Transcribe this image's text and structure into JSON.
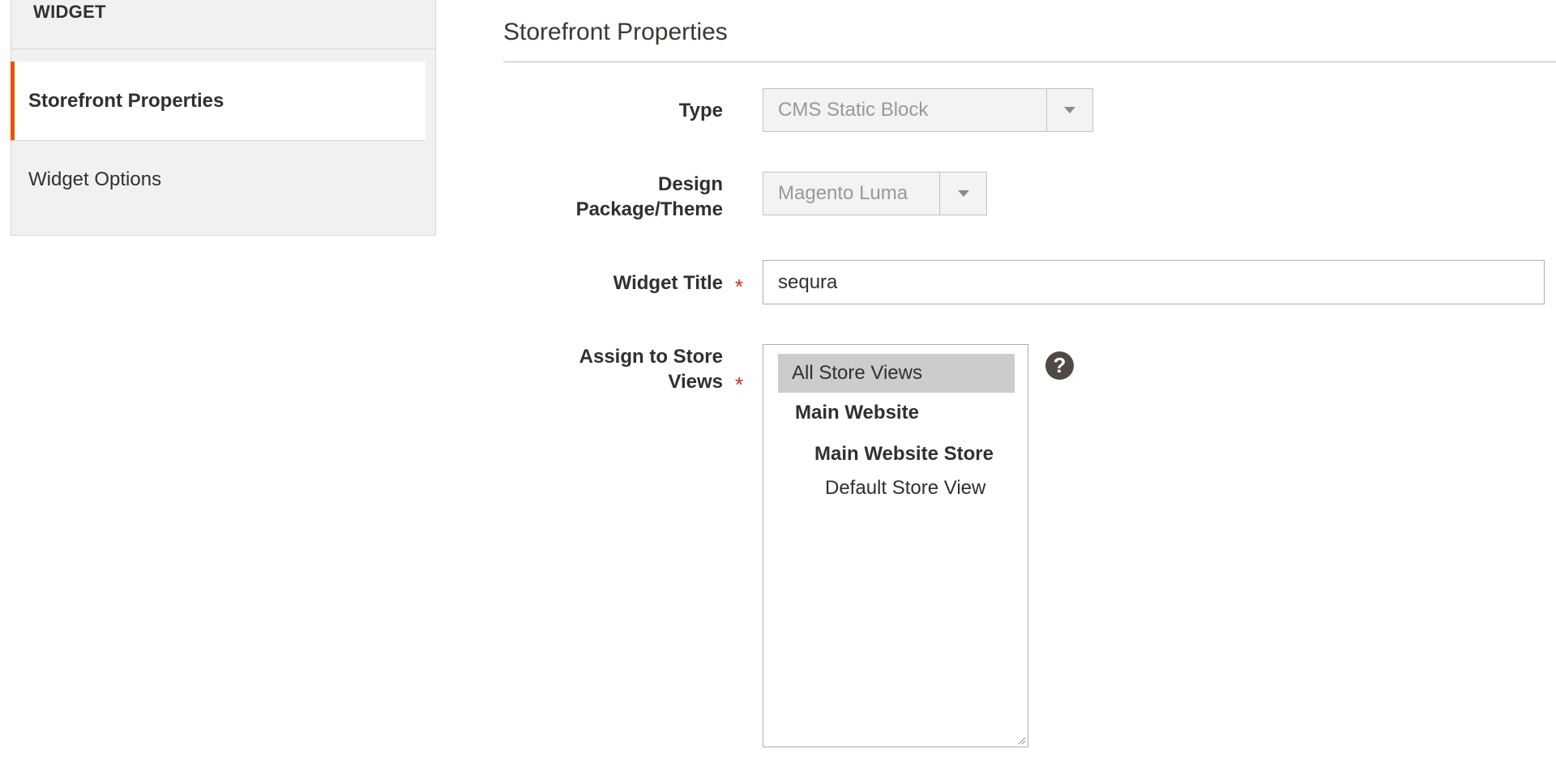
{
  "sidebar": {
    "heading": "WIDGET",
    "tabs": [
      {
        "label": "Storefront Properties",
        "active": true
      },
      {
        "label": "Widget Options",
        "active": false
      }
    ],
    "accent_color": "#eb5202"
  },
  "main": {
    "section_title": "Storefront Properties",
    "fields": {
      "type": {
        "label": "Type",
        "value": "CMS Static Block",
        "disabled": true
      },
      "design_theme": {
        "label_line1": "Design",
        "label_line2": "Package/Theme",
        "value": "Magento Luma",
        "disabled": true
      },
      "widget_title": {
        "label": "Widget Title",
        "required": true,
        "value": "sequra"
      },
      "store_views": {
        "label_line1": "Assign to Store",
        "label_line2": "Views",
        "required": true,
        "options": {
          "all": "All Store Views",
          "website": "Main Website",
          "store": "Main Website Store",
          "view": "Default Store View"
        },
        "selected": "All Store Views",
        "help_icon": "question-icon"
      }
    },
    "required_marker": "*",
    "help_glyph": "?"
  }
}
